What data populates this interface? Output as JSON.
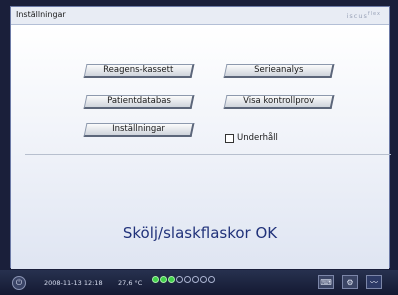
{
  "window": {
    "title": "Inställningar",
    "brand": "iscus",
    "brand_sup": "flex"
  },
  "buttons": {
    "reagens_kassett": "Reagens-kassett",
    "serieanalys": "Serieanalys",
    "patientdatabas": "Patientdatabas",
    "visa_kontrollprov": "Visa kontrollprov",
    "installningar": "Inställningar"
  },
  "maintenance": {
    "label": "Underhåll",
    "checked": false
  },
  "status_message": "Skölj/slaskflaskor OK",
  "statusbar": {
    "datetime": "2008-11-13 12:18",
    "temperature": "27,6 °C",
    "indicators": [
      true,
      true,
      true,
      false,
      false,
      false,
      false,
      false
    ]
  },
  "icons": [
    "power-icon",
    "keyboard-icon",
    "gear-icon",
    "chart-icon"
  ]
}
